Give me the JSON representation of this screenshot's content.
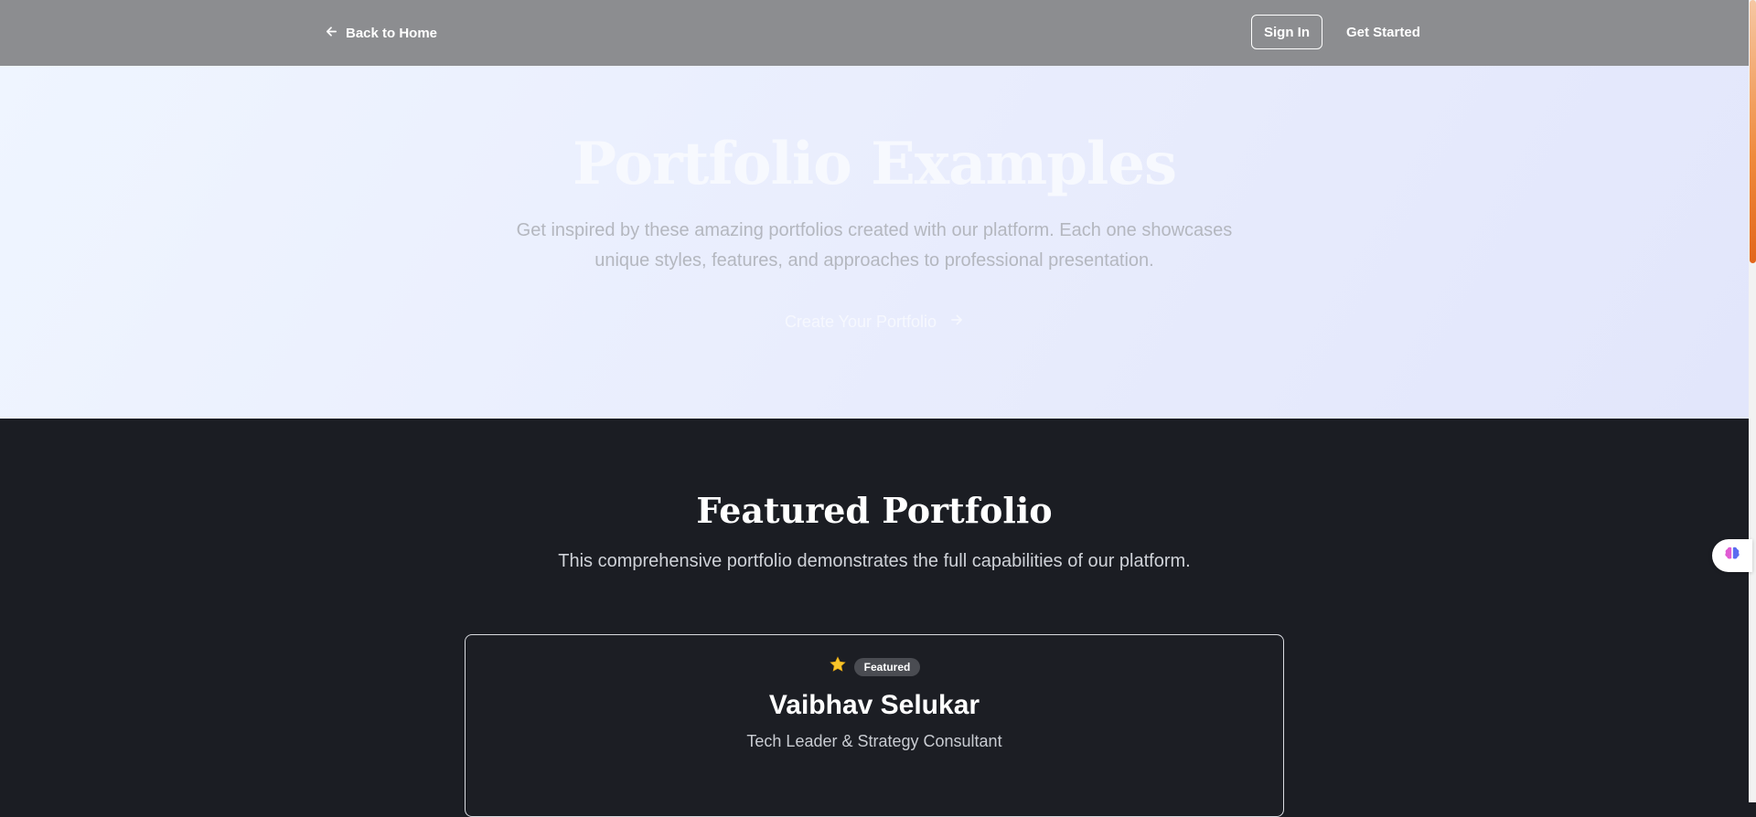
{
  "nav": {
    "back_label": "Back to Home",
    "signin_label": "Sign In",
    "get_started_label": "Get Started"
  },
  "hero": {
    "title": "Portfolio Examples",
    "subtitle": "Get inspired by these amazing portfolios created with our platform. Each one showcases unique styles, features, and approaches to professional presentation.",
    "cta_label": "Create Your Portfolio"
  },
  "featured": {
    "title": "Featured Portfolio",
    "subtitle": "This comprehensive portfolio demonstrates the full capabilities of our platform.",
    "card": {
      "badge": "Featured",
      "name": "Vaibhav Selukar",
      "role": "Tech Leader & Strategy Consultant"
    }
  },
  "icons": {
    "back": "arrow-left-icon",
    "cta": "arrow-right-icon",
    "badge": "star-icon",
    "widget": "brain-icon"
  },
  "colors": {
    "nav_bg": "#8c8d90",
    "dark_bg": "#1b1d23",
    "badge_bg": "#4a4c52",
    "scroll_accent": "#e2661b"
  }
}
